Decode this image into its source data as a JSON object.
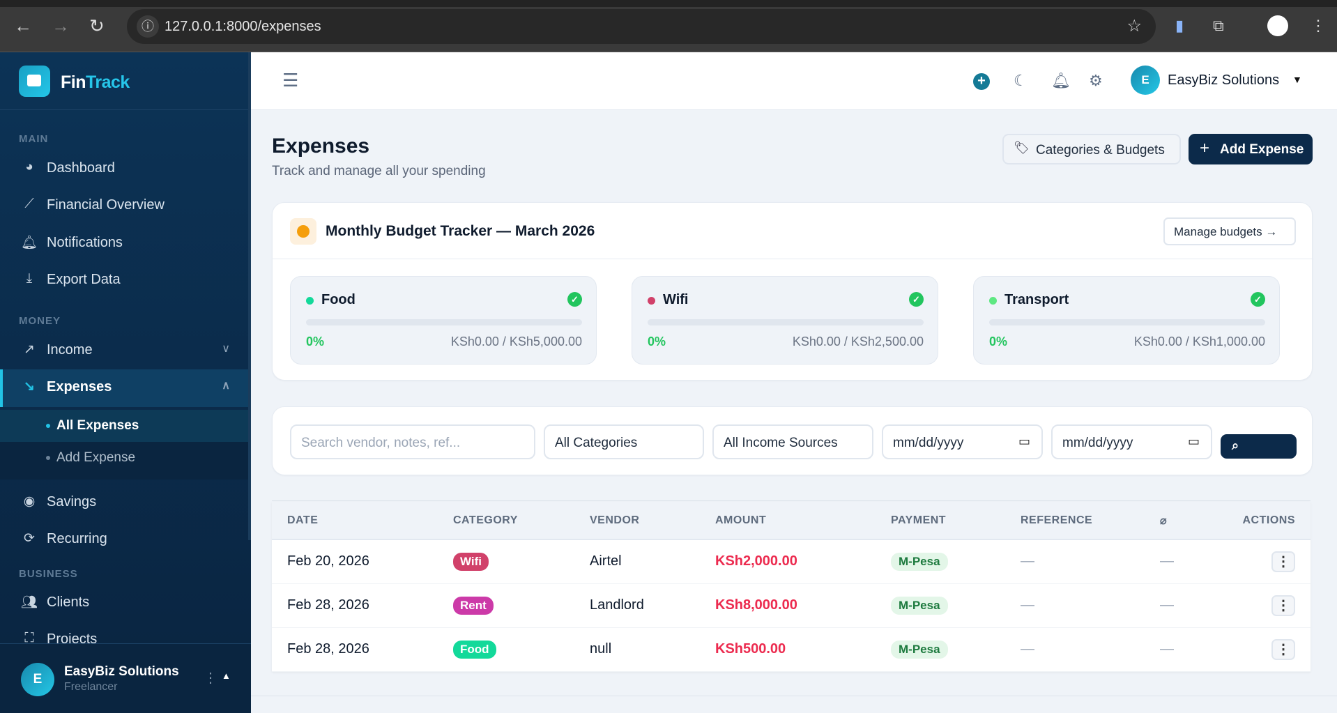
{
  "browser": {
    "url": "127.0.0.1:8000/expenses"
  },
  "sidebar": {
    "brand_first": "Fin",
    "brand_second": "Track",
    "sections": {
      "main": "MAIN",
      "money": "MONEY",
      "business": "BUSINESS"
    },
    "items": {
      "dashboard": "Dashboard",
      "financial_overview": "Financial Overview",
      "notifications": "Notifications",
      "export_data": "Export Data",
      "income": "Income",
      "expenses": "Expenses",
      "all_expenses": "All Expenses",
      "add_expense": "Add Expense",
      "savings": "Savings",
      "recurring": "Recurring",
      "clients": "Clients",
      "projects": "Projects"
    },
    "user": {
      "initial": "E",
      "name": "EasyBiz Solutions",
      "role": "Freelancer"
    }
  },
  "topbar": {
    "user_initial": "E",
    "user_name": "EasyBiz Solutions"
  },
  "page": {
    "title": "Expenses",
    "subtitle": "Track and manage all your spending",
    "categories_button": "Categories & Budgets",
    "add_button": "Add Expense"
  },
  "budget": {
    "title": "Monthly Budget Tracker — March 2026",
    "manage": "Manage budgets",
    "items": [
      {
        "name": "Food",
        "color": "#13d99a",
        "percent": "0%",
        "fill": 0,
        "amount": "KSh0.00 / KSh5,000.00"
      },
      {
        "name": "Wifi",
        "color": "#d1416a",
        "percent": "0%",
        "fill": 0,
        "amount": "KSh0.00 / KSh2,500.00"
      },
      {
        "name": "Transport",
        "color": "#5ee882",
        "percent": "0%",
        "fill": 0,
        "amount": "KSh0.00 / KSh1,000.00"
      }
    ]
  },
  "filters": {
    "search_placeholder": "Search vendor, notes, ref...",
    "category": "All Categories",
    "source": "All Income Sources",
    "date_from": "mm/dd/yyyy",
    "date_to": "mm/dd/yyyy"
  },
  "table": {
    "headers": {
      "date": "DATE",
      "category": "CATEGORY",
      "vendor": "VENDOR",
      "amount": "AMOUNT",
      "payment": "PAYMENT",
      "reference": "REFERENCE",
      "actions": "ACTIONS"
    },
    "rows": [
      {
        "date": "Feb 20, 2026",
        "category": "Wifi",
        "category_color": "#d1416a",
        "vendor": "Airtel",
        "amount": "KSh2,000.00",
        "payment": "M-Pesa",
        "reference": "—",
        "attachment": "—"
      },
      {
        "date": "Feb 28, 2026",
        "category": "Rent",
        "category_color": "#cc3aa8",
        "vendor": "Landlord",
        "amount": "KSh8,000.00",
        "payment": "M-Pesa",
        "reference": "—",
        "attachment": "—"
      },
      {
        "date": "Feb 28, 2026",
        "category": "Food",
        "category_color": "#13d99a",
        "vendor": "null",
        "amount": "KSh500.00",
        "payment": "M-Pesa",
        "reference": "—",
        "attachment": "—"
      }
    ]
  }
}
